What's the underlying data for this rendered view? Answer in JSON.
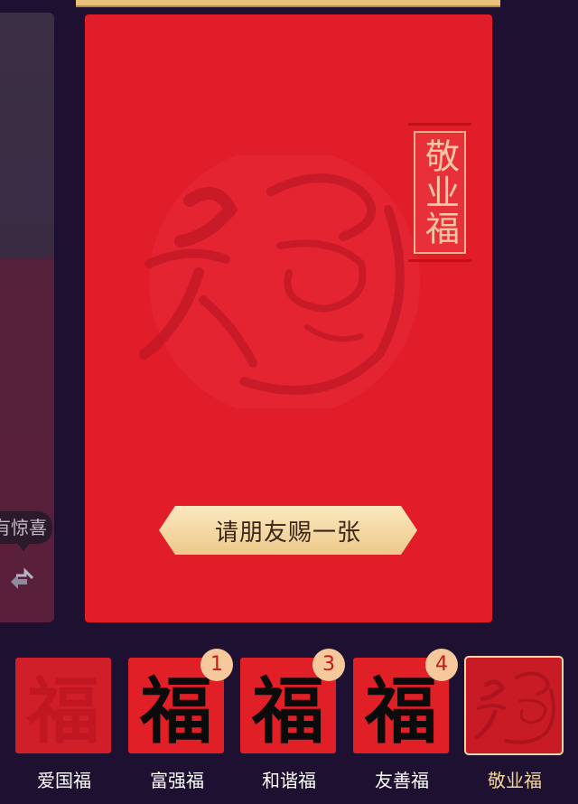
{
  "side_card": {
    "bubble_text": "有惊喜"
  },
  "main_card": {
    "stamp_text": "敬业福",
    "action_button": "请朋友赐一张"
  },
  "cards": [
    {
      "label": "爱国福",
      "glyph": "福",
      "count": "",
      "state": "empty"
    },
    {
      "label": "富强福",
      "glyph": "福",
      "count": "1",
      "state": "owned"
    },
    {
      "label": "和谐福",
      "glyph": "福",
      "count": "3",
      "state": "owned"
    },
    {
      "label": "友善福",
      "glyph": "福",
      "count": "4",
      "state": "owned"
    },
    {
      "label": "敬业福",
      "glyph": "",
      "count": "",
      "state": "selected"
    }
  ],
  "colors": {
    "background": "#1d1030",
    "card_red": "#e21d2a",
    "gold": "#f2d49b",
    "badge": "#f5c99b"
  }
}
